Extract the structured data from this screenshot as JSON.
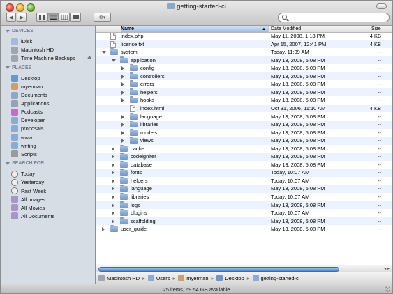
{
  "window": {
    "title": "getting-started-ci"
  },
  "toolbar": {
    "back_glyph": "◀",
    "forward_glyph": "▶",
    "action_glyph": "⚙▾",
    "search_placeholder": ""
  },
  "sidebar": {
    "sections": [
      {
        "title": "DEVICES",
        "items": [
          {
            "label": "iDisk",
            "icon": "idisk-icon"
          },
          {
            "label": "Macintosh HD",
            "icon": "hard-drive-icon"
          },
          {
            "label": "Time Machine Backups",
            "icon": "hard-drive-icon",
            "eject": "⏏"
          }
        ]
      },
      {
        "title": "PLACES",
        "items": [
          {
            "label": "Desktop",
            "icon": "desktop-icon"
          },
          {
            "label": "myerman",
            "icon": "home-icon"
          },
          {
            "label": "Documents",
            "icon": "documents-icon"
          },
          {
            "label": "Applications",
            "icon": "applications-icon"
          },
          {
            "label": "Podcasts",
            "icon": "podcasts-icon"
          },
          {
            "label": "Developer",
            "icon": "folder-icon"
          },
          {
            "label": "proposals",
            "icon": "folder-icon"
          },
          {
            "label": "www",
            "icon": "folder-icon"
          },
          {
            "label": "writing",
            "icon": "folder-icon"
          },
          {
            "label": "Scripts",
            "icon": "scripts-icon"
          }
        ]
      },
      {
        "title": "SEARCH FOR",
        "items": [
          {
            "label": "Today",
            "icon": "clock-icon"
          },
          {
            "label": "Yesterday",
            "icon": "clock-icon"
          },
          {
            "label": "Past Week",
            "icon": "clock-icon"
          },
          {
            "label": "All Images",
            "icon": "smart-folder-icon"
          },
          {
            "label": "All Movies",
            "icon": "smart-folder-icon"
          },
          {
            "label": "All Documents",
            "icon": "smart-folder-icon"
          }
        ]
      }
    ]
  },
  "columns": {
    "name": "Name",
    "date": "Date Modified",
    "size": "Size",
    "sort_glyph": "▲"
  },
  "files": [
    {
      "name": "index.php",
      "date": "May 11, 2008, 1:18 PM",
      "size": "4 KB",
      "kind": "file",
      "depth": 0,
      "disclosure": "none"
    },
    {
      "name": "license.txt",
      "date": "Apr 15, 2007, 12:41 PM",
      "size": "4 KB",
      "kind": "file",
      "depth": 0,
      "disclosure": "none"
    },
    {
      "name": "system",
      "date": "Today, 11:09 AM",
      "size": "--",
      "kind": "folder",
      "depth": 0,
      "disclosure": "open"
    },
    {
      "name": "application",
      "date": "May 13, 2008, 5:08 PM",
      "size": "--",
      "kind": "folder",
      "depth": 1,
      "disclosure": "open"
    },
    {
      "name": "config",
      "date": "May 13, 2008, 5:08 PM",
      "size": "--",
      "kind": "folder",
      "depth": 2,
      "disclosure": "closed"
    },
    {
      "name": "controllers",
      "date": "May 13, 2008, 5:08 PM",
      "size": "--",
      "kind": "folder",
      "depth": 2,
      "disclosure": "closed"
    },
    {
      "name": "errors",
      "date": "May 13, 2008, 5:08 PM",
      "size": "--",
      "kind": "folder",
      "depth": 2,
      "disclosure": "closed"
    },
    {
      "name": "helpers",
      "date": "May 13, 2008, 5:08 PM",
      "size": "--",
      "kind": "folder",
      "depth": 2,
      "disclosure": "closed"
    },
    {
      "name": "hooks",
      "date": "May 13, 2008, 5:08 PM",
      "size": "--",
      "kind": "folder",
      "depth": 2,
      "disclosure": "closed"
    },
    {
      "name": "index.html",
      "date": "Oct 31, 2006, 11:10 AM",
      "size": "4 KB",
      "kind": "file",
      "depth": 2,
      "disclosure": "none"
    },
    {
      "name": "language",
      "date": "May 13, 2008, 5:08 PM",
      "size": "--",
      "kind": "folder",
      "depth": 2,
      "disclosure": "closed"
    },
    {
      "name": "libraries",
      "date": "May 13, 2008, 5:08 PM",
      "size": "--",
      "kind": "folder",
      "depth": 2,
      "disclosure": "closed"
    },
    {
      "name": "models",
      "date": "May 13, 2008, 5:08 PM",
      "size": "--",
      "kind": "folder",
      "depth": 2,
      "disclosure": "closed"
    },
    {
      "name": "views",
      "date": "May 13, 2008, 5:08 PM",
      "size": "--",
      "kind": "folder",
      "depth": 2,
      "disclosure": "closed"
    },
    {
      "name": "cache",
      "date": "May 13, 2008, 5:08 PM",
      "size": "--",
      "kind": "folder",
      "depth": 1,
      "disclosure": "closed"
    },
    {
      "name": "codeigniter",
      "date": "May 13, 2008, 5:08 PM",
      "size": "--",
      "kind": "folder",
      "depth": 1,
      "disclosure": "closed"
    },
    {
      "name": "database",
      "date": "May 13, 2008, 5:08 PM",
      "size": "--",
      "kind": "folder",
      "depth": 1,
      "disclosure": "closed"
    },
    {
      "name": "fonts",
      "date": "Today, 10:07 AM",
      "size": "--",
      "kind": "folder",
      "depth": 1,
      "disclosure": "closed"
    },
    {
      "name": "helpers",
      "date": "Today, 10:07 AM",
      "size": "--",
      "kind": "folder",
      "depth": 1,
      "disclosure": "closed"
    },
    {
      "name": "language",
      "date": "May 13, 2008, 5:08 PM",
      "size": "--",
      "kind": "folder",
      "depth": 1,
      "disclosure": "closed"
    },
    {
      "name": "libraries",
      "date": "Today, 10:07 AM",
      "size": "--",
      "kind": "folder",
      "depth": 1,
      "disclosure": "closed"
    },
    {
      "name": "logs",
      "date": "May 13, 2008, 5:08 PM",
      "size": "--",
      "kind": "folder",
      "depth": 1,
      "disclosure": "closed"
    },
    {
      "name": "plugins",
      "date": "Today, 10:07 AM",
      "size": "--",
      "kind": "folder",
      "depth": 1,
      "disclosure": "closed"
    },
    {
      "name": "scaffolding",
      "date": "May 13, 2008, 5:08 PM",
      "size": "--",
      "kind": "folder",
      "depth": 1,
      "disclosure": "closed"
    },
    {
      "name": "user_guide",
      "date": "May 13, 2008, 5:08 PM",
      "size": "--",
      "kind": "folder",
      "depth": 0,
      "disclosure": "closed"
    }
  ],
  "pathbar": [
    "Macintosh HD",
    "Users",
    "myerman",
    "Desktop",
    "getting-started-ci"
  ],
  "pathbar_separator": "▸",
  "scroll_arrows": "◂ ▸",
  "status": "25 items, 69.54 GB available",
  "colors": {
    "sidebar_bg": "#d7dde5",
    "alt_row": "#edf3fe",
    "folder": "#8aabd3",
    "scroll_thumb": "#4d85cc"
  }
}
